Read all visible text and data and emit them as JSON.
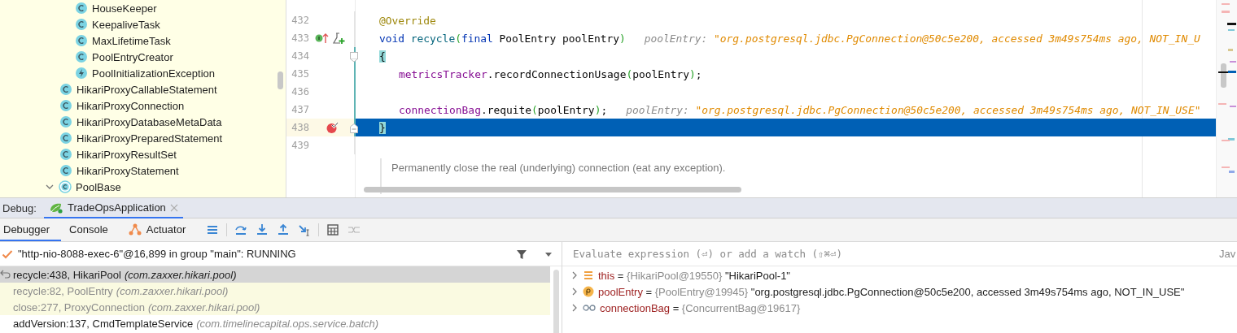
{
  "project_tree": {
    "items": [
      {
        "children": [
          {
            "label": "HouseKeeper",
            "kind": "class",
            "expanded": false
          },
          {
            "label": "KeepaliveTask",
            "kind": "class",
            "expanded": false
          },
          {
            "label": "MaxLifetimeTask",
            "kind": "class",
            "expanded": false
          },
          {
            "label": "PoolEntryCreator",
            "kind": "class",
            "expanded": false
          },
          {
            "label": "PoolInitializationException",
            "kind": "exception",
            "expanded": false
          }
        ]
      },
      {
        "label": "HikariProxyCallableStatement",
        "kind": "class",
        "expanded": false
      },
      {
        "label": "HikariProxyConnection",
        "kind": "class",
        "expanded": false
      },
      {
        "label": "HikariProxyDatabaseMetaData",
        "kind": "class",
        "expanded": false
      },
      {
        "label": "HikariProxyPreparedStatement",
        "kind": "class",
        "expanded": false
      },
      {
        "label": "HikariProxyResultSet",
        "kind": "class",
        "expanded": false
      },
      {
        "label": "HikariProxyStatement",
        "kind": "class",
        "expanded": false
      },
      {
        "label": "PoolBase",
        "kind": "abstract",
        "expanded": true
      }
    ]
  },
  "editor": {
    "lines": [
      {
        "number": "432",
        "kind": "member",
        "current": false,
        "changed": false,
        "tokens": [
          {
            "kind": "annotation",
            "text": "@Override"
          }
        ]
      },
      {
        "number": "433",
        "kind": "member",
        "current": false,
        "changed": false,
        "gutter": [
          {
            "kind": "implements"
          },
          {
            "kind": "test"
          }
        ],
        "tokens": [
          {
            "kind": "keyword",
            "text": "void "
          },
          {
            "kind": "method",
            "text": "recycle"
          },
          {
            "kind": "paren",
            "text": "("
          },
          {
            "kind": "keyword",
            "text": "final"
          },
          {
            "kind": "plain",
            "text": " PoolEntry poolEntry"
          },
          {
            "kind": "paren",
            "text": ")"
          }
        ],
        "hint": {
          "name": "poolEntry:",
          "value": "\"org.postgresql.jdbc.PgConnection@50c5e200, accessed 3m49s754ms ago, NOT_IN_U"
        }
      },
      {
        "number": "434",
        "kind": "member",
        "current": false,
        "changed": true,
        "gutter": [
          {
            "kind": "fold_start"
          }
        ],
        "tokens": [
          {
            "kind": "brace_match",
            "text": "{"
          }
        ]
      },
      {
        "number": "435",
        "kind": "statement",
        "current": false,
        "changed": true,
        "tokens": [
          {
            "kind": "field",
            "text": "metricsTracker"
          },
          {
            "kind": "plain",
            "text": ".recordConnectionUsage"
          },
          {
            "kind": "paren",
            "text": "("
          },
          {
            "kind": "plain",
            "text": "poolEntry"
          },
          {
            "kind": "paren",
            "text": ")"
          },
          {
            "kind": "plain",
            "text": ";"
          }
        ]
      },
      {
        "number": "436",
        "kind": "statement",
        "current": false,
        "changed": true
      },
      {
        "number": "437",
        "kind": "statement",
        "current": false,
        "changed": true,
        "tokens": [
          {
            "kind": "field",
            "text": "connectionBag"
          },
          {
            "kind": "plain",
            "text": ".requite"
          },
          {
            "kind": "paren",
            "text": "("
          },
          {
            "kind": "plain",
            "text": "poolEntry"
          },
          {
            "kind": "paren",
            "text": ")"
          },
          {
            "kind": "plain",
            "text": ";"
          }
        ],
        "hint": {
          "name": "poolEntry:",
          "value": "\"org.postgresql.jdbc.PgConnection@50c5e200, accessed 3m49s754ms ago, NOT_IN_USE\""
        }
      },
      {
        "number": "438",
        "kind": "member",
        "current": true,
        "changed": true,
        "gutter": [
          {
            "kind": "breakpoint"
          },
          {
            "kind": "fold_end"
          }
        ],
        "tokens": [
          {
            "kind": "brace_match",
            "text": "}"
          }
        ]
      },
      {
        "number": "439",
        "kind": "member",
        "current": false,
        "changed": false
      }
    ],
    "doc_comment": "Permanently close the real (underlying) connection (eat any exception)."
  },
  "debug": {
    "title": "Debug:",
    "session_tab": "TradeOpsApplication",
    "tabs": [
      {
        "label": "Debugger",
        "selected": true,
        "kind": "plain"
      },
      {
        "label": "Console",
        "selected": false,
        "kind": "plain"
      },
      {
        "label": "Actuator",
        "selected": false,
        "kind": "actuator"
      }
    ],
    "actions": [
      {
        "kind": "layout",
        "disabled": false
      },
      {
        "kind": "step_over",
        "disabled": false
      },
      {
        "kind": "step_into",
        "disabled": false
      },
      {
        "kind": "step_out",
        "disabled": false
      },
      {
        "kind": "run_to_cursor",
        "disabled": false
      },
      {
        "kind": "evaluate",
        "disabled": false
      },
      {
        "kind": "trace",
        "disabled": true
      }
    ],
    "thread": "\"http-nio-8088-exec-6\"@16,899 in group \"main\": RUNNING",
    "frames": [
      {
        "method": "recycle:438, HikariPool",
        "package": "(com.zaxxer.hikari.pool)",
        "selected": true,
        "dimmed": false
      },
      {
        "method": "recycle:82, PoolEntry",
        "package": "(com.zaxxer.hikari.pool)",
        "selected": false,
        "dimmed": true
      },
      {
        "method": "close:277, ProxyConnection",
        "package": "(com.zaxxer.hikari.pool)",
        "selected": false,
        "dimmed": true
      },
      {
        "method": "addVersion:137, CmdTemplateService",
        "package": "(com.timelinecapital.ops.service.batch)",
        "selected": false,
        "dimmed": false
      }
    ],
    "watch": {
      "placeholder": "Evaluate expression (⏎) or add a watch (⇧⌘⏎)",
      "language": "Jav"
    },
    "variables": [
      {
        "kind": "object",
        "name": "this",
        "operator": "=",
        "type": "{HikariPool@19550}",
        "value": "\"HikariPool-1\""
      },
      {
        "kind": "parameter",
        "name": "poolEntry",
        "operator": "=",
        "type": "{PoolEntry@19945}",
        "value": "\"org.postgresql.jdbc.PgConnection@50c5e200, accessed 3m49s754ms ago, NOT_IN_USE\""
      },
      {
        "kind": "watch",
        "name": "connectionBag",
        "operator": "=",
        "type": "{ConcurrentBag@19617}"
      }
    ]
  }
}
